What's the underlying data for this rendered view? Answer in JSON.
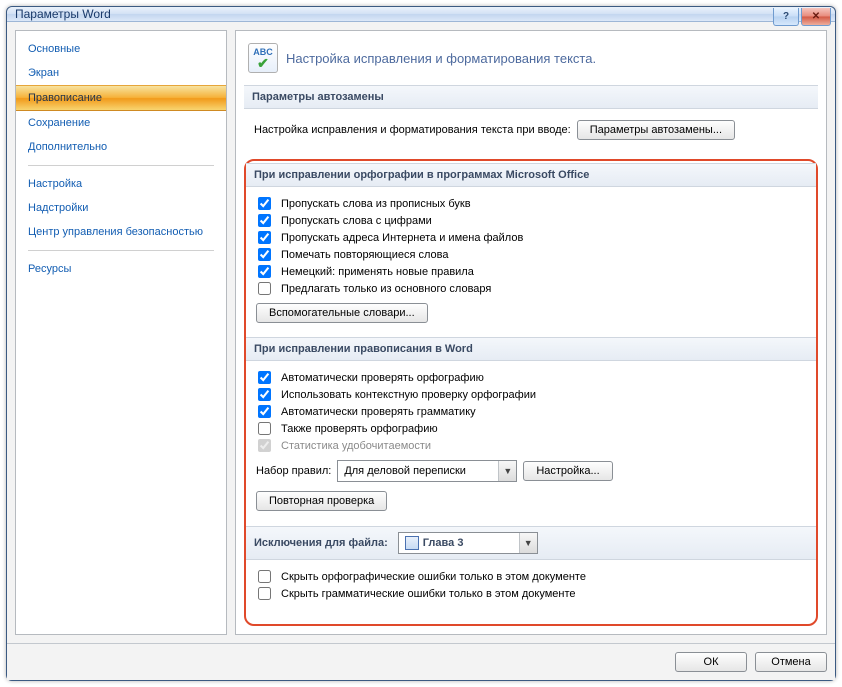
{
  "window": {
    "title": "Параметры Word"
  },
  "sidebar": {
    "items": [
      "Основные",
      "Экран",
      "Правописание",
      "Сохранение",
      "Дополнительно",
      "Настройка",
      "Надстройки",
      "Центр управления безопасностью",
      "Ресурсы"
    ],
    "selected_index": 2,
    "separators_after": [
      4,
      7
    ]
  },
  "header": {
    "icon_text": "ABC",
    "text": "Настройка исправления и форматирования текста."
  },
  "sections": {
    "autocorrect": {
      "title": "Параметры автозамены",
      "desc": "Настройка исправления и форматирования текста при вводе:",
      "button": "Параметры автозамены..."
    },
    "office_spell": {
      "title": "При исправлении орфографии в программах Microsoft Office",
      "options": [
        {
          "label": "Пропускать слова из прописных букв",
          "checked": true
        },
        {
          "label": "Пропускать слова с цифрами",
          "checked": true
        },
        {
          "label": "Пропускать адреса Интернета и имена файлов",
          "checked": true
        },
        {
          "label": "Помечать повторяющиеся слова",
          "checked": true
        },
        {
          "label": "Немецкий: применять новые правила",
          "checked": true
        },
        {
          "label": "Предлагать только из основного словаря",
          "checked": false
        }
      ],
      "dict_button": "Вспомогательные словари..."
    },
    "word_spell": {
      "title": "При исправлении правописания в Word",
      "options": [
        {
          "label": "Автоматически проверять орфографию",
          "checked": true
        },
        {
          "label": "Использовать контекстную проверку орфографии",
          "checked": true
        },
        {
          "label": "Автоматически проверять грамматику",
          "checked": true
        },
        {
          "label": "Также проверять орфографию",
          "checked": false
        },
        {
          "label": "Статистика удобочитаемости",
          "checked": true,
          "disabled": true
        }
      ],
      "ruleset_label": "Набор правил:",
      "ruleset_value": "Для деловой переписки",
      "settings_button": "Настройка...",
      "recheck_button": "Повторная проверка"
    },
    "exceptions": {
      "title": "Исключения для файла:",
      "file_value": "Глава 3",
      "options": [
        {
          "label": "Скрыть орфографические ошибки только в этом документе",
          "checked": false
        },
        {
          "label": "Скрыть грамматические ошибки только в этом документе",
          "checked": false
        }
      ]
    }
  },
  "footer": {
    "ok": "ОК",
    "cancel": "Отмена"
  }
}
